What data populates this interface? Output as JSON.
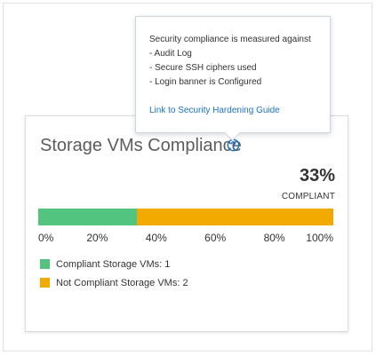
{
  "tooltip": {
    "lines": [
      "Security compliance is measured against",
      "- Audit Log",
      "- Secure SSH ciphers used",
      "- Login banner is Configured"
    ],
    "link_label": "Link to Security Hardening Guide"
  },
  "card": {
    "title": "Storage VMs Compliance",
    "help_icon": "question-circle-icon",
    "percent": "33%",
    "percent_caption": "COMPLIANT"
  },
  "chart_data": {
    "type": "bar",
    "orientation": "horizontal-stacked",
    "x_ticks": [
      "0%",
      "20%",
      "40%",
      "60%",
      "80%",
      "100%"
    ],
    "xlim": [
      0,
      100
    ],
    "series": [
      {
        "name": "Compliant Storage VMs: 1",
        "value": 1,
        "color": "#52c47f"
      },
      {
        "name": "Not Compliant Storage VMs: 2",
        "value": 2,
        "color": "#f2a900"
      }
    ],
    "legend_position": "bottom-left"
  },
  "colors": {
    "compliant": "#52c47f",
    "non_compliant": "#f2a900",
    "link": "#1a73c6",
    "help_icon": "#1a73c6"
  }
}
